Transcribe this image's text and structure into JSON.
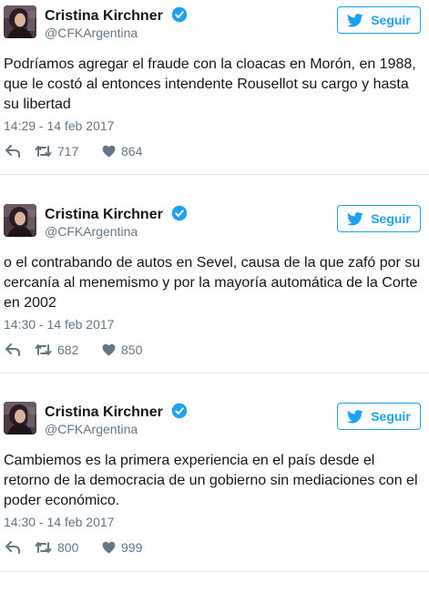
{
  "follow_label": "Seguir",
  "accent_color": "#1da1f2",
  "verified_color": "#1da1f2",
  "tweets": [
    {
      "name": "Cristina Kirchner",
      "handle": "@CFKArgentina",
      "text": "Podríamos agregar el fraude con la cloacas en Morón, en 1988, que le costó al entonces intendente Rousellot su cargo y hasta su libertad",
      "time": "14:29 - 14 feb 2017",
      "retweets": "717",
      "likes": "864"
    },
    {
      "name": "Cristina Kirchner",
      "handle": "@CFKArgentina",
      "text": "o el contrabando de autos en Sevel, causa de la que zafó por su cercanía al menemismo y por la mayoría automática de la Corte en 2002",
      "time": "14:30 - 14 feb 2017",
      "retweets": "682",
      "likes": "850"
    },
    {
      "name": "Cristina Kirchner",
      "handle": "@CFKArgentina",
      "text": "Cambiemos es la primera experiencia en el país desde el retorno de la democracia de un gobierno sin mediaciones con el poder económico.",
      "time": "14:30 - 14 feb 2017",
      "retweets": "800",
      "likes": "999"
    }
  ],
  "icons": [
    "avatar",
    "verified-badge-icon",
    "twitter-bird-icon",
    "reply-icon",
    "retweet-icon",
    "heart-icon"
  ]
}
